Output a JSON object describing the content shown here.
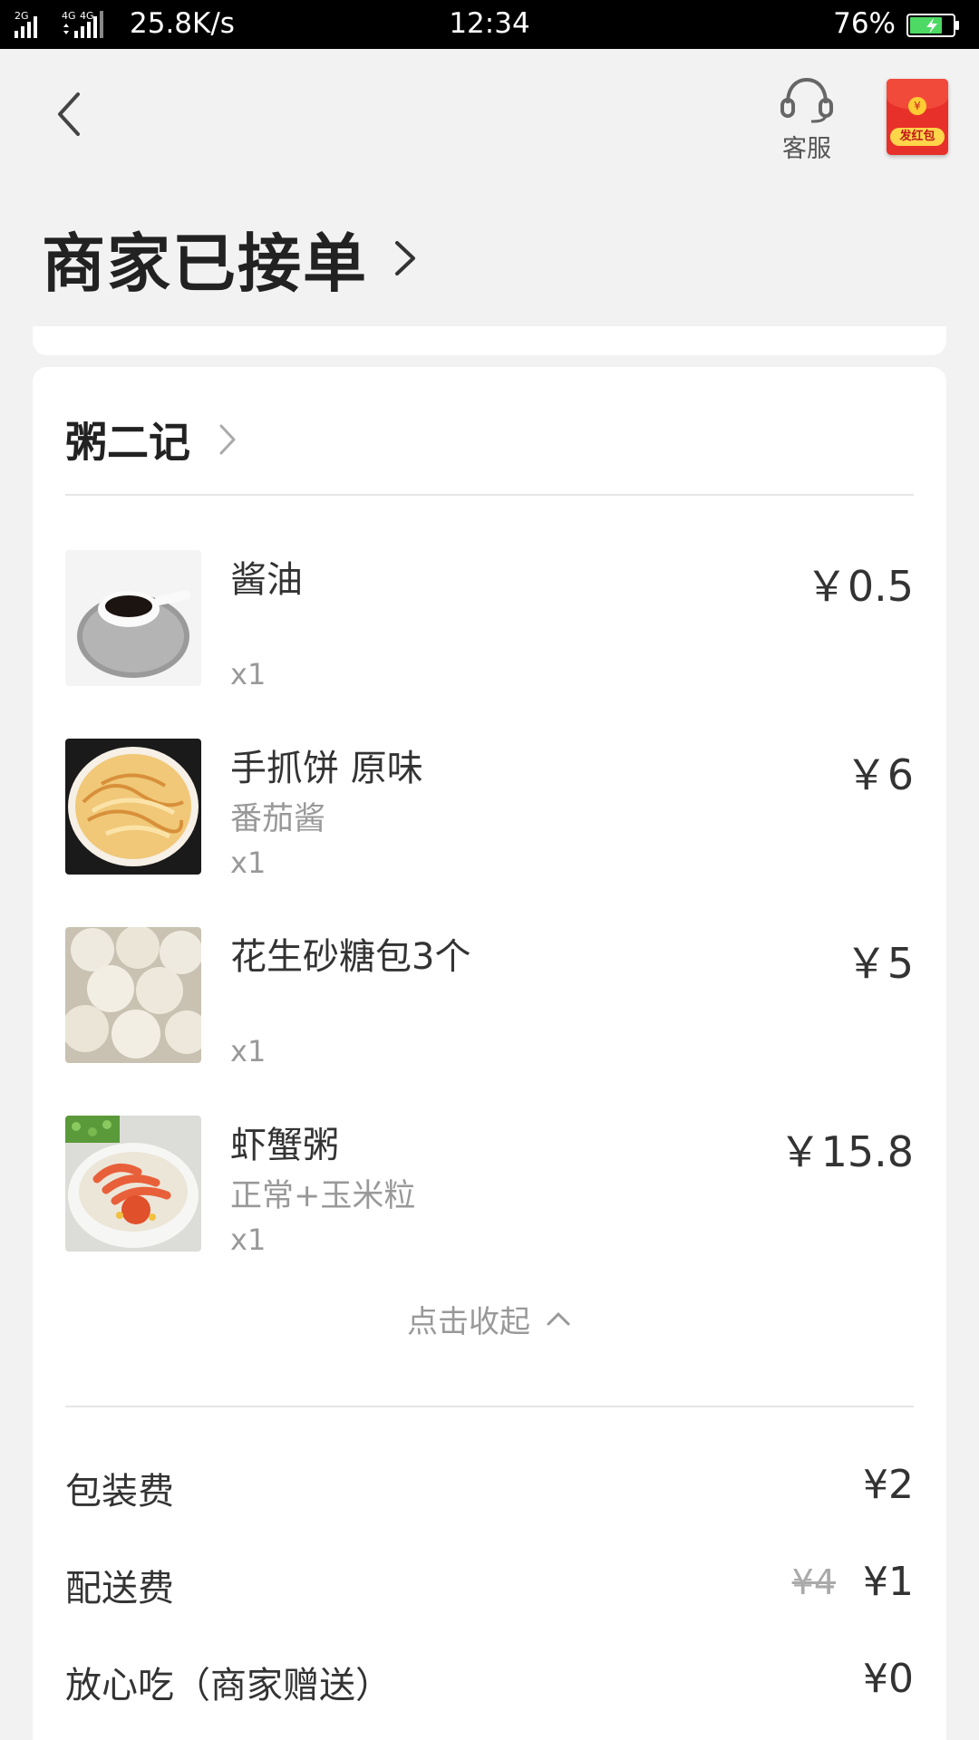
{
  "status_bar": {
    "net_labels": [
      "2G",
      "4G",
      "4G"
    ],
    "speed": "25.8K/s",
    "time": "12:34",
    "battery": "76%",
    "battery_level": 0.76
  },
  "header": {
    "customer_service_label": "客服",
    "red_packet_label": "发红包"
  },
  "order_status": "商家已接单",
  "shop": {
    "name": "粥二记"
  },
  "items": [
    {
      "name": "酱油",
      "spec": "",
      "qty": "x1",
      "price": "￥0.5",
      "image": "soy-sauce"
    },
    {
      "name": "手抓饼 原味",
      "spec": "番茄酱",
      "qty": "x1",
      "price": "￥6",
      "image": "scallion-pancake"
    },
    {
      "name": "花生砂糖包3个",
      "spec": "",
      "qty": "x1",
      "price": "￥5",
      "image": "sugar-buns"
    },
    {
      "name": "虾蟹粥",
      "spec": "正常+玉米粒",
      "qty": "x1",
      "price": "￥15.8",
      "image": "shrimp-crab-congee"
    }
  ],
  "collapse_label": "点击收起",
  "fees": [
    {
      "label": "包装费",
      "value": "¥2",
      "original": ""
    },
    {
      "label": "配送费",
      "value": "¥1",
      "original": "¥4"
    },
    {
      "label": "放心吃（商家赠送）",
      "value": "¥0",
      "original": ""
    }
  ],
  "colors": {
    "red_packet": "#e8302a",
    "battery_fill": "#4cd964",
    "muted_text": "#999999"
  }
}
